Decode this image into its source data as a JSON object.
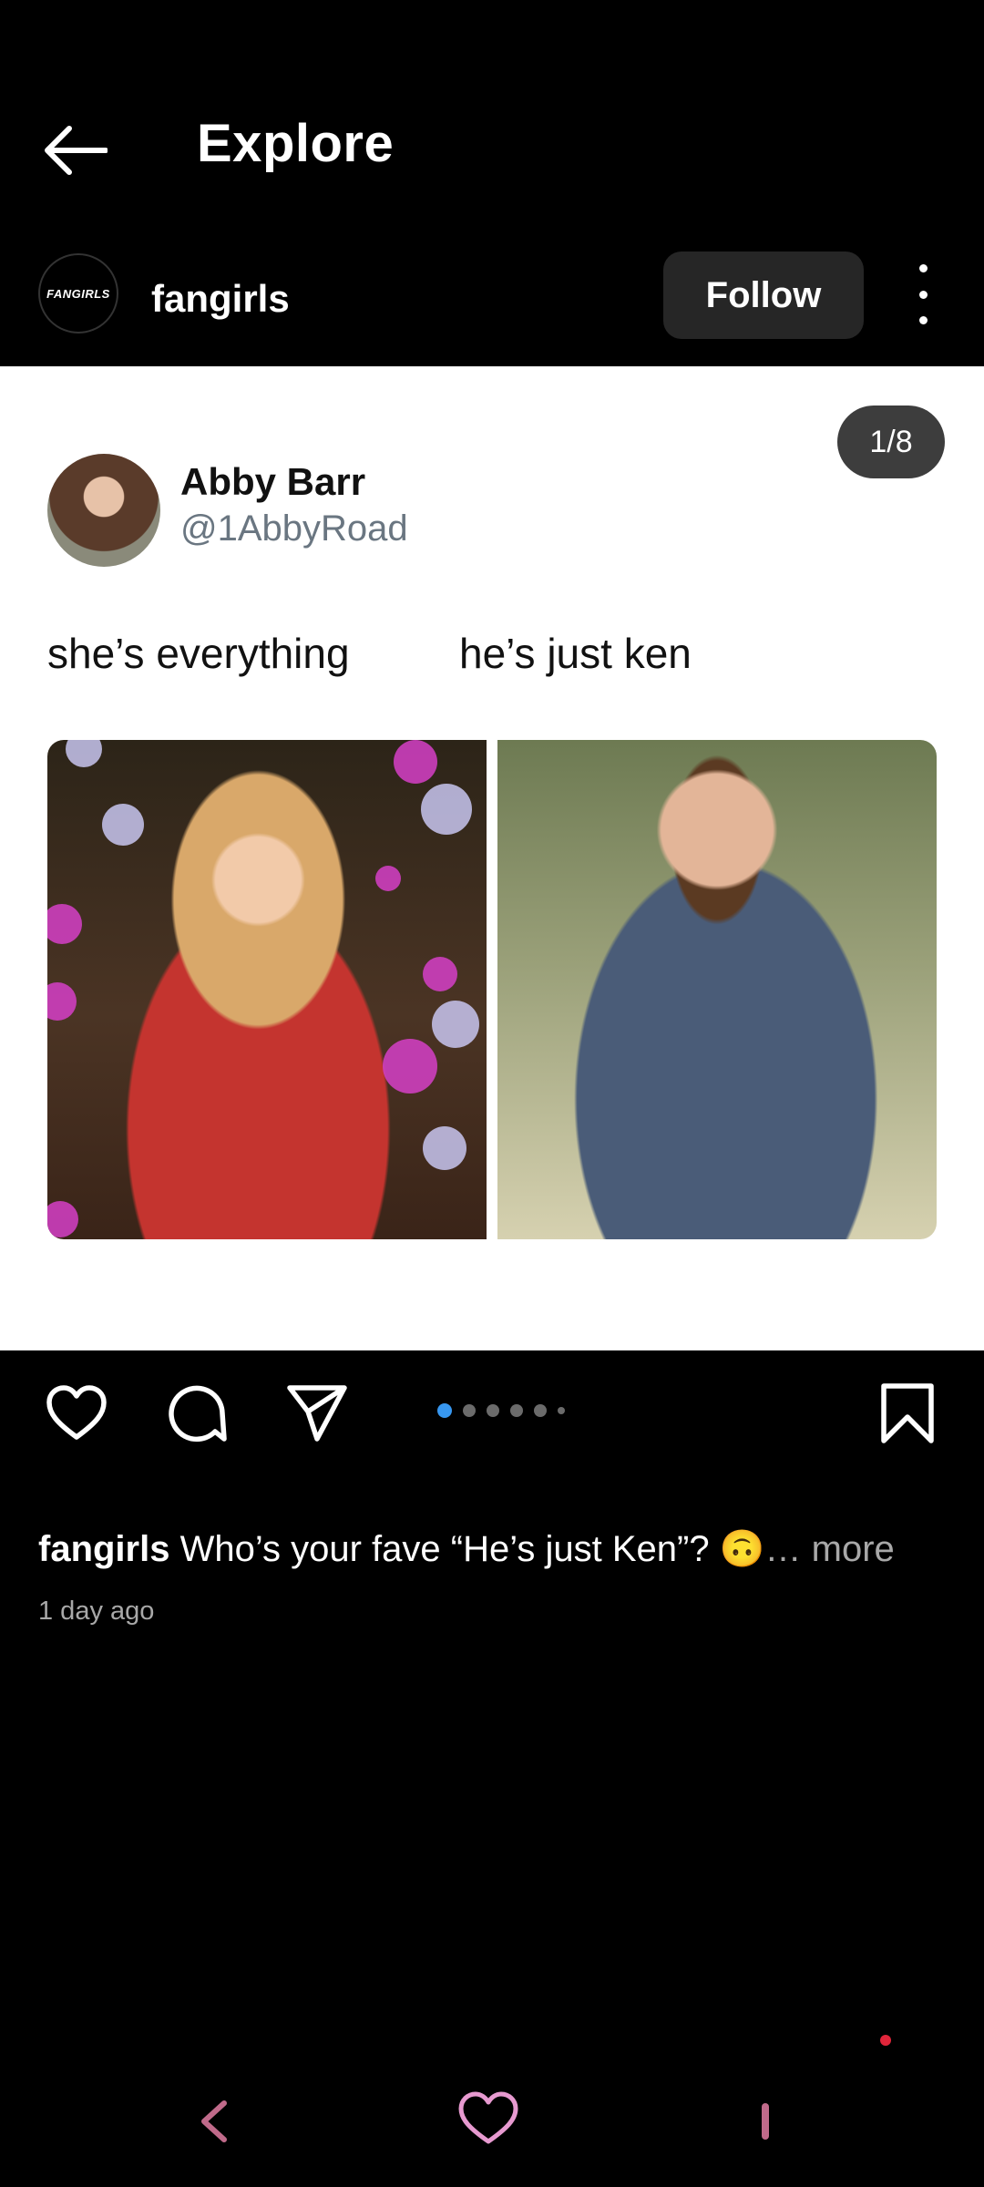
{
  "header": {
    "title": "Explore"
  },
  "account": {
    "avatar_text": "FANGIRLS",
    "name": "fangirls",
    "follow_label": "Follow"
  },
  "post": {
    "counter": "1/8",
    "tweet": {
      "name": "Abby Barr",
      "handle": "@1AbbyRoad",
      "caption_left": "she’s everything",
      "caption_right": "he’s just ken"
    }
  },
  "pager": {
    "total": 6,
    "active_index": 0
  },
  "caption": {
    "username": "fangirls",
    "text": " Who’s your fave “He’s just Ken”? 🙃",
    "more": "… more",
    "time": "1 day ago"
  },
  "colors": {
    "accent": "#3797f0",
    "follow_bg": "#262626",
    "notification_dot": "#e0253a"
  }
}
